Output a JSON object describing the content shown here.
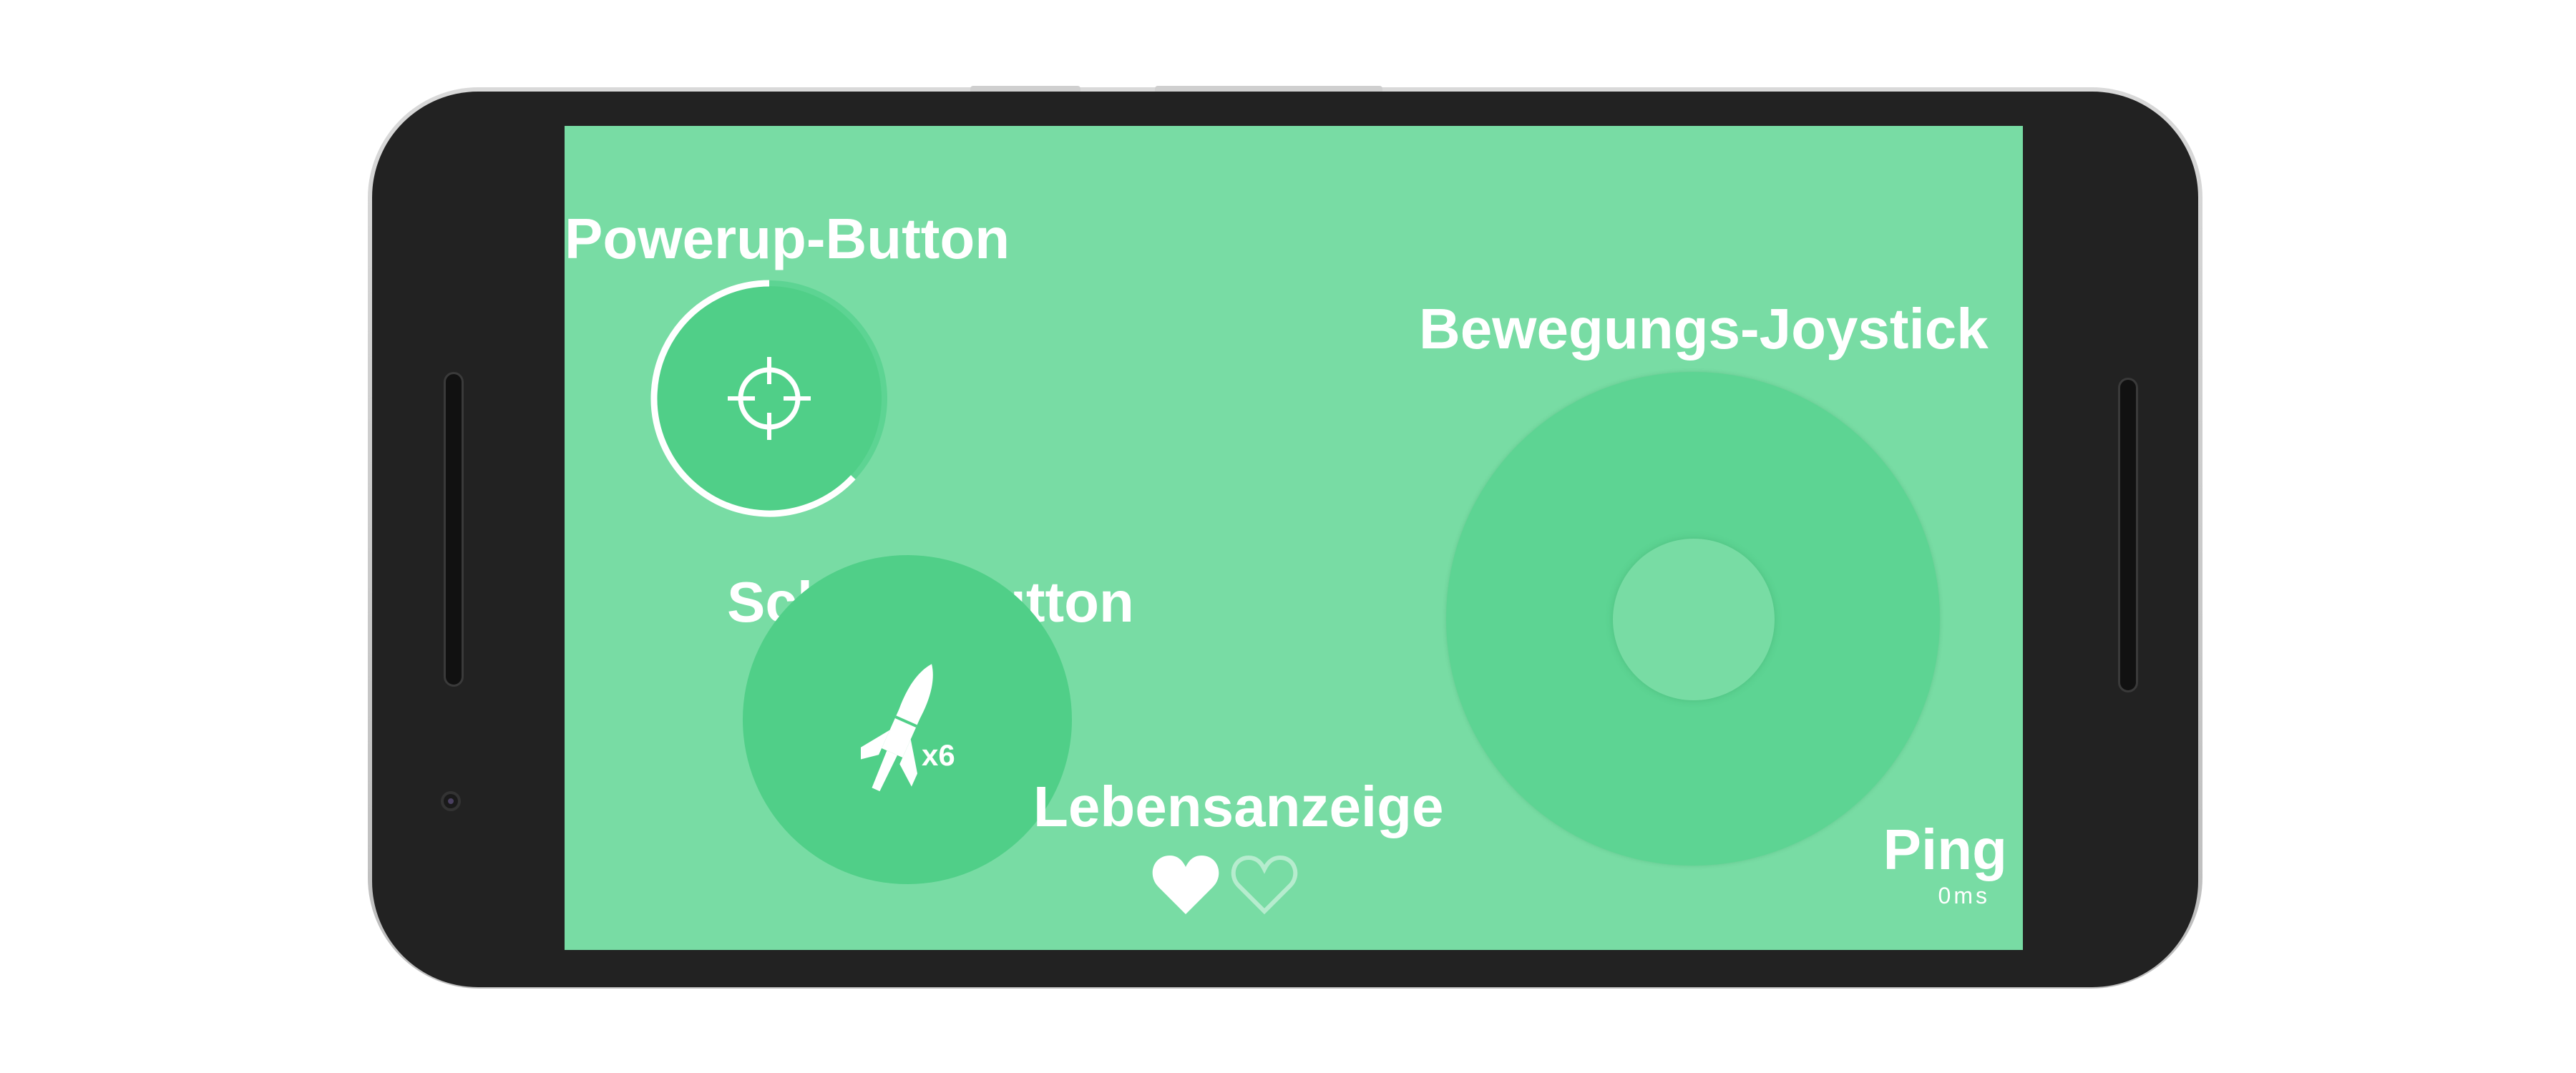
{
  "labels": {
    "powerup": "Powerup-Button",
    "shoot": "Schuss-Button",
    "joystick": "Bewegungs-Joystick",
    "lives": "Lebensanzeige",
    "ping": "Ping"
  },
  "shoot": {
    "ammo": "x6"
  },
  "ping": {
    "value": "0ms"
  },
  "lives": {
    "current": 1,
    "max": 2
  },
  "powerup": {
    "cooldown_progress": 0.63
  },
  "icons": {
    "powerup": "crosshair-icon",
    "shoot": "rocket-icon",
    "life_full": "heart-filled-icon",
    "life_empty": "heart-outline-icon"
  },
  "colors": {
    "screen_bg": "#78dca4",
    "button_fill": "#50cf88",
    "joystick_fill": "#5dd493",
    "text": "#ffffff",
    "phone_body": "#222222"
  }
}
